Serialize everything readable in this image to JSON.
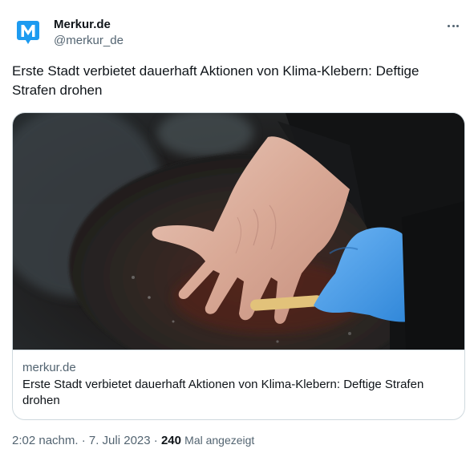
{
  "author": {
    "display_name": "Merkur.de",
    "handle": "@merkur_de",
    "brand_color": "#1d9bf0",
    "avatar_icon": "merkur-logo-icon",
    "avatar_letter": "M"
  },
  "more_icon": "more-dots-icon",
  "tweet": {
    "text": "Erste Stadt verbietet dauerhaft Aktionen von Klima-Klebern: Deftige Strafen drohen"
  },
  "card": {
    "domain": "merkur.de",
    "title": "Erste Stadt verbietet dauerhaft Aktionen von Klima-Klebern: Deftige Strafen drohen"
  },
  "meta": {
    "timestamp": "2:02 nachm. · 7. Juli 2023",
    "separator": "·",
    "views_count": "240",
    "views_label": "Mal angezeigt"
  }
}
